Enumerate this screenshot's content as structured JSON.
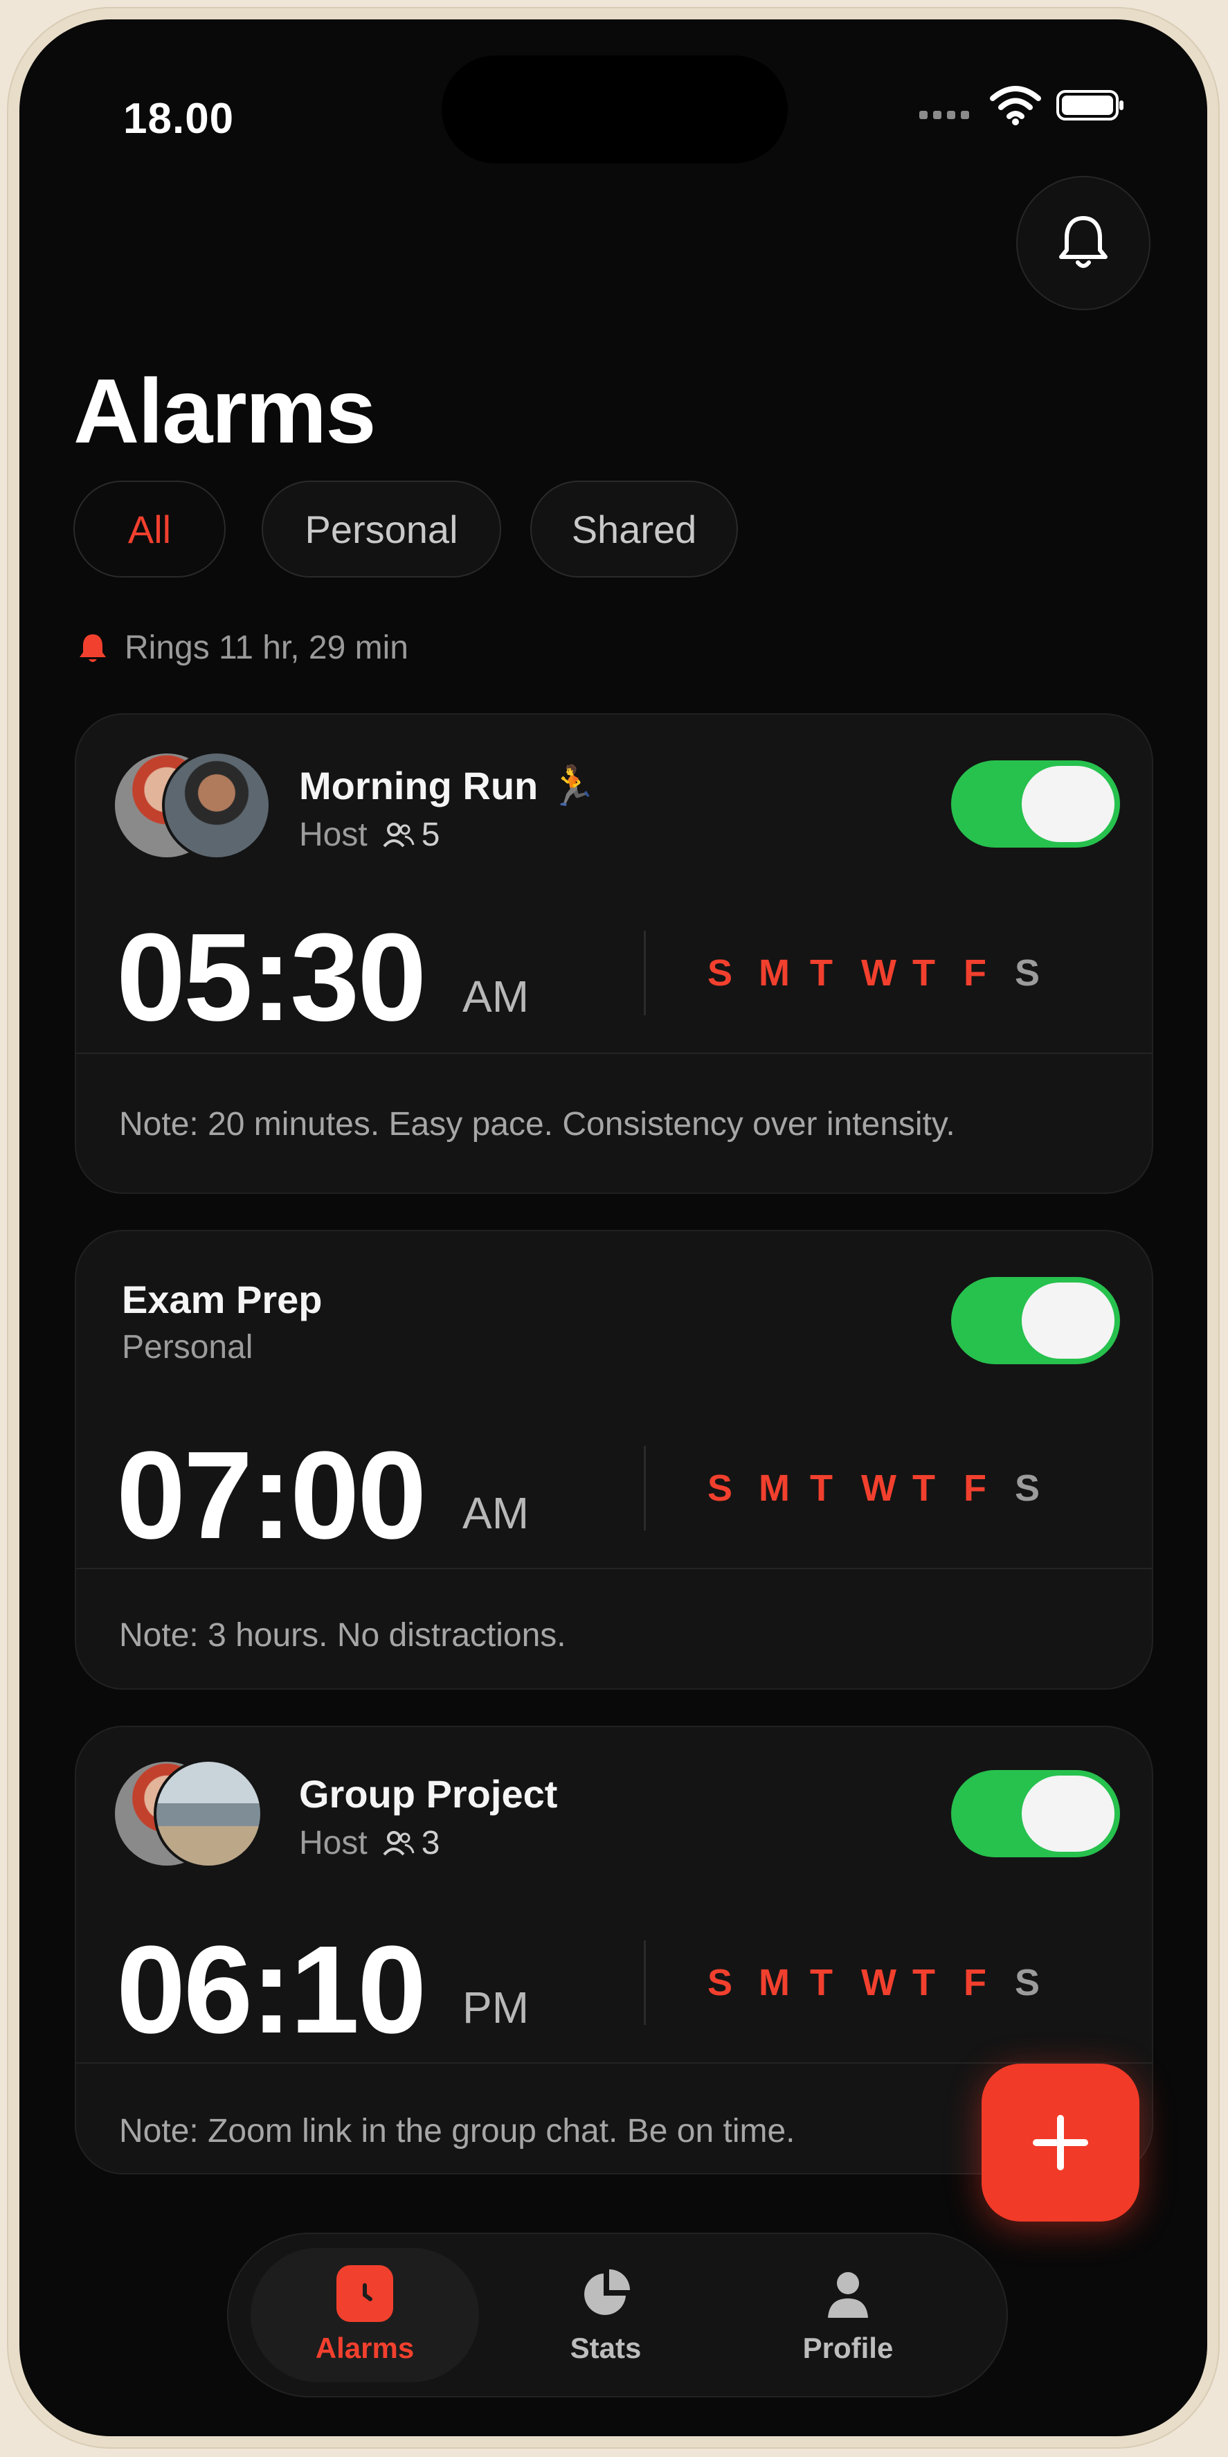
{
  "status_bar": {
    "time": "18.00"
  },
  "header": {
    "title": "Alarms",
    "bell_icon": "bell-icon"
  },
  "filters": [
    {
      "label": "All",
      "active": true
    },
    {
      "label": "Personal",
      "active": false
    },
    {
      "label": "Shared",
      "active": false
    }
  ],
  "next_ring": "Rings 11 hr, 29 min",
  "alarms": [
    {
      "title": "Morning Run",
      "emoji": "🏃",
      "sub": "Host",
      "members": "5",
      "time": "05:30",
      "ampm": "AM",
      "enabled": true,
      "days": [
        "S",
        "M",
        "T",
        "W",
        "T",
        "F",
        "S"
      ],
      "note": "Note: 20 minutes. Easy pace. Consistency over intensity."
    },
    {
      "title": "Exam Prep",
      "sub": "Personal",
      "time": "07:00",
      "ampm": "AM",
      "enabled": true,
      "days": [
        "S",
        "M",
        "T",
        "W",
        "T",
        "F",
        "S"
      ],
      "note": "Note: 3 hours. No distractions."
    },
    {
      "title": "Group Project",
      "sub": "Host",
      "members": "3",
      "time": "06:10",
      "ampm": "PM",
      "enabled": true,
      "days": [
        "S",
        "M",
        "T",
        "W",
        "T",
        "F",
        "S"
      ],
      "note": "Note: Zoom link in the group chat. Be on time."
    }
  ],
  "fab": {
    "icon": "plus-icon"
  },
  "tabs": [
    {
      "label": "Alarms",
      "icon": "clock-icon",
      "active": true
    },
    {
      "label": "Stats",
      "icon": "pie-chart-icon",
      "active": false
    },
    {
      "label": "Profile",
      "icon": "person-icon",
      "active": false
    }
  ],
  "colors": {
    "accent": "#f2402e",
    "toggle_on": "#27c14e",
    "background": "#090909",
    "card": "#141414"
  }
}
